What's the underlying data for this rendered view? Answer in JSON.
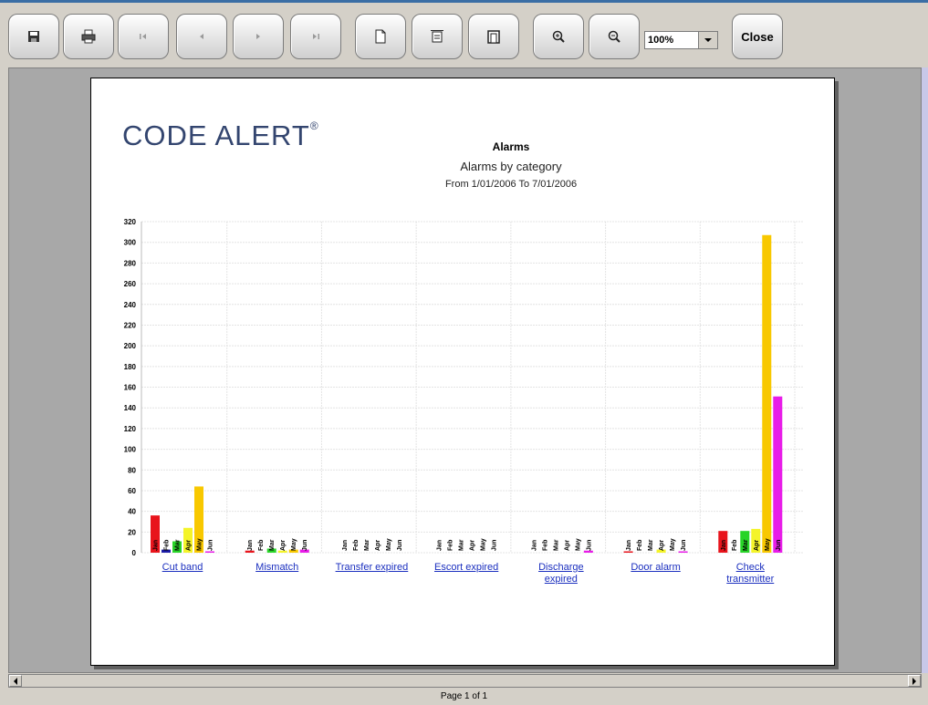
{
  "toolbar": {
    "zoom_value": "100%",
    "close_label": "Close"
  },
  "report": {
    "logo_text": "CODE ALERT",
    "logo_mark": "®",
    "title": "Alarms",
    "subtitle": "Alarms by category",
    "date_range": "From 1/01/2006 To 7/01/2006"
  },
  "status": {
    "page_text": "Page 1 of 1"
  },
  "chart_data": {
    "type": "bar",
    "categories": [
      "Cut band",
      "Mismatch",
      "Transfer expired",
      "Escort expired",
      "Discharge expired",
      "Door alarm",
      "Check transmitter"
    ],
    "category_lines": [
      [
        "Cut band"
      ],
      [
        "Mismatch"
      ],
      [
        "Transfer expired"
      ],
      [
        "Escort expired"
      ],
      [
        "Discharge",
        "expired"
      ],
      [
        "Door alarm"
      ],
      [
        "Check",
        "transmitter"
      ]
    ],
    "months": [
      "Jan",
      "Feb",
      "Mar",
      "Apr",
      "May",
      "Jun"
    ],
    "month_colors": [
      "#e8141c",
      "#1c1ca8",
      "#28d428",
      "#f4f42a",
      "#f8c800",
      "#e81ce8"
    ],
    "series": [
      {
        "name": "Jan",
        "values": [
          36,
          2,
          0,
          0,
          0,
          1,
          21
        ]
      },
      {
        "name": "Feb",
        "values": [
          3,
          0,
          0,
          0,
          0,
          0,
          0
        ]
      },
      {
        "name": "Mar",
        "values": [
          11,
          4,
          0,
          0,
          0,
          0,
          21
        ]
      },
      {
        "name": "Apr",
        "values": [
          24,
          2,
          0,
          0,
          0,
          3,
          23
        ]
      },
      {
        "name": "May",
        "values": [
          64,
          3,
          0,
          0,
          0,
          0,
          307
        ]
      },
      {
        "name": "Jun",
        "values": [
          1,
          3,
          0,
          0,
          2,
          1,
          151
        ]
      }
    ],
    "ylim": [
      0,
      320
    ],
    "yticks": [
      0,
      20,
      40,
      60,
      80,
      100,
      120,
      140,
      160,
      180,
      200,
      220,
      240,
      260,
      280,
      300,
      320
    ],
    "grid": true
  }
}
